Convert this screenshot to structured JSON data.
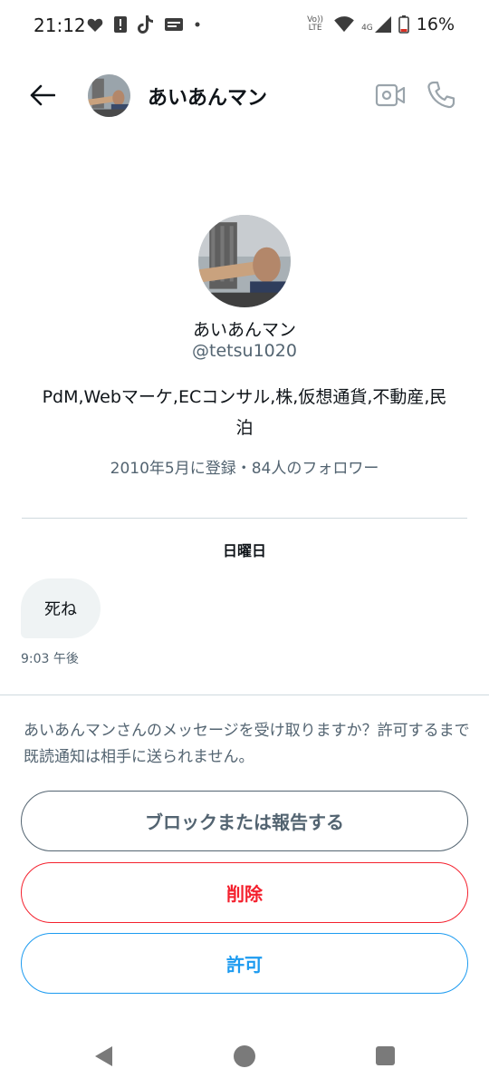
{
  "status_bar": {
    "time": "21:12",
    "battery_percent": "16%",
    "network_small_label": "4G",
    "volte_label_1": "Vo))",
    "volte_label_2": "LTE",
    "left_icons": [
      "heart-icon",
      "alert-icon",
      "tiktok-icon",
      "gift-icon",
      "dot-icon"
    ],
    "right_icons": [
      "volte-icon",
      "wifi-icon",
      "signal-icon",
      "battery-icon"
    ]
  },
  "header": {
    "back_icon": "arrow-left-icon",
    "name": "あいあんマン",
    "video_icon": "video-call-icon",
    "call_icon": "phone-icon"
  },
  "profile": {
    "name": "あいあんマン",
    "handle": "@tetsu1020",
    "bio": "PdM,Webマーケ,ECコンサル,株,仮想通貨,不動産,民泊",
    "meta": "2010年5月に登録・84人のフォロワー"
  },
  "conversation": {
    "day_label": "日曜日",
    "messages": [
      {
        "text": "死ね",
        "time": "9:03 午後"
      }
    ]
  },
  "request_panel": {
    "text": "あいあんマンさんのメッセージを受け取りますか？許可するまで既読通知は相手に送られません。",
    "block_label": "ブロックまたは報告する",
    "delete_label": "削除",
    "allow_label": "許可"
  },
  "colors": {
    "text_primary": "#0f1419",
    "text_secondary": "#536471",
    "danger": "#f4212e",
    "accent": "#1d9bf0",
    "bubble_bg": "#eff3f4",
    "divider": "#cfd9de"
  },
  "nav_bar": {
    "icons": [
      "nav-back-icon",
      "nav-home-icon",
      "nav-recents-icon"
    ]
  }
}
